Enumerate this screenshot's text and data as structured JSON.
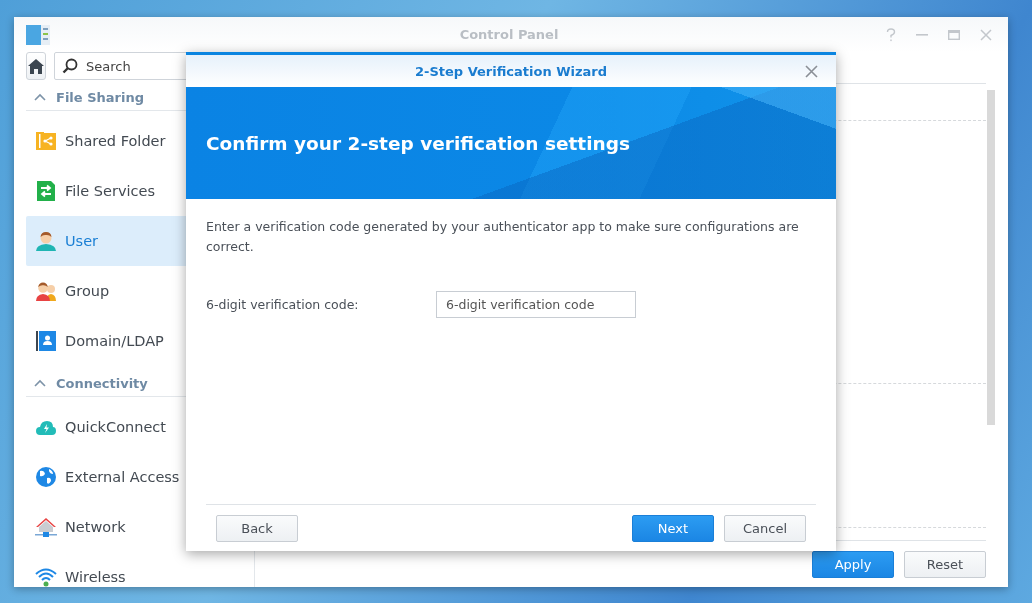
{
  "window": {
    "title": "Control Panel"
  },
  "sidebar": {
    "search": {
      "placeholder": "Search"
    },
    "sections": [
      {
        "title": "File Sharing",
        "expanded": true,
        "items": [
          {
            "label": "Shared Folder",
            "selected": false
          },
          {
            "label": "File Services",
            "selected": false
          },
          {
            "label": "User",
            "selected": true
          },
          {
            "label": "Group",
            "selected": false
          },
          {
            "label": "Domain/LDAP",
            "selected": false
          }
        ]
      },
      {
        "title": "Connectivity",
        "expanded": true,
        "items": [
          {
            "label": "QuickConnect",
            "selected": false
          },
          {
            "label": "External Access",
            "selected": false
          },
          {
            "label": "Network",
            "selected": false
          },
          {
            "label": "Wireless",
            "selected": false
          }
        ]
      }
    ]
  },
  "footer_buttons": [
    {
      "label": "Apply",
      "kind": "primary"
    },
    {
      "label": "Reset",
      "kind": "default"
    }
  ],
  "dialog": {
    "title": "2-Step Verification Wizard",
    "heading": "Confirm your 2-step verification settings",
    "description": "Enter a verification code generated by your authenticator app to make sure configurations are correct.",
    "field": {
      "label": "6-digit verification code:",
      "placeholder": "6-digit verification code"
    },
    "buttons": [
      {
        "label": "Back",
        "kind": "default"
      },
      {
        "label": "Next",
        "kind": "primary"
      },
      {
        "label": "Cancel",
        "kind": "default"
      }
    ]
  }
}
